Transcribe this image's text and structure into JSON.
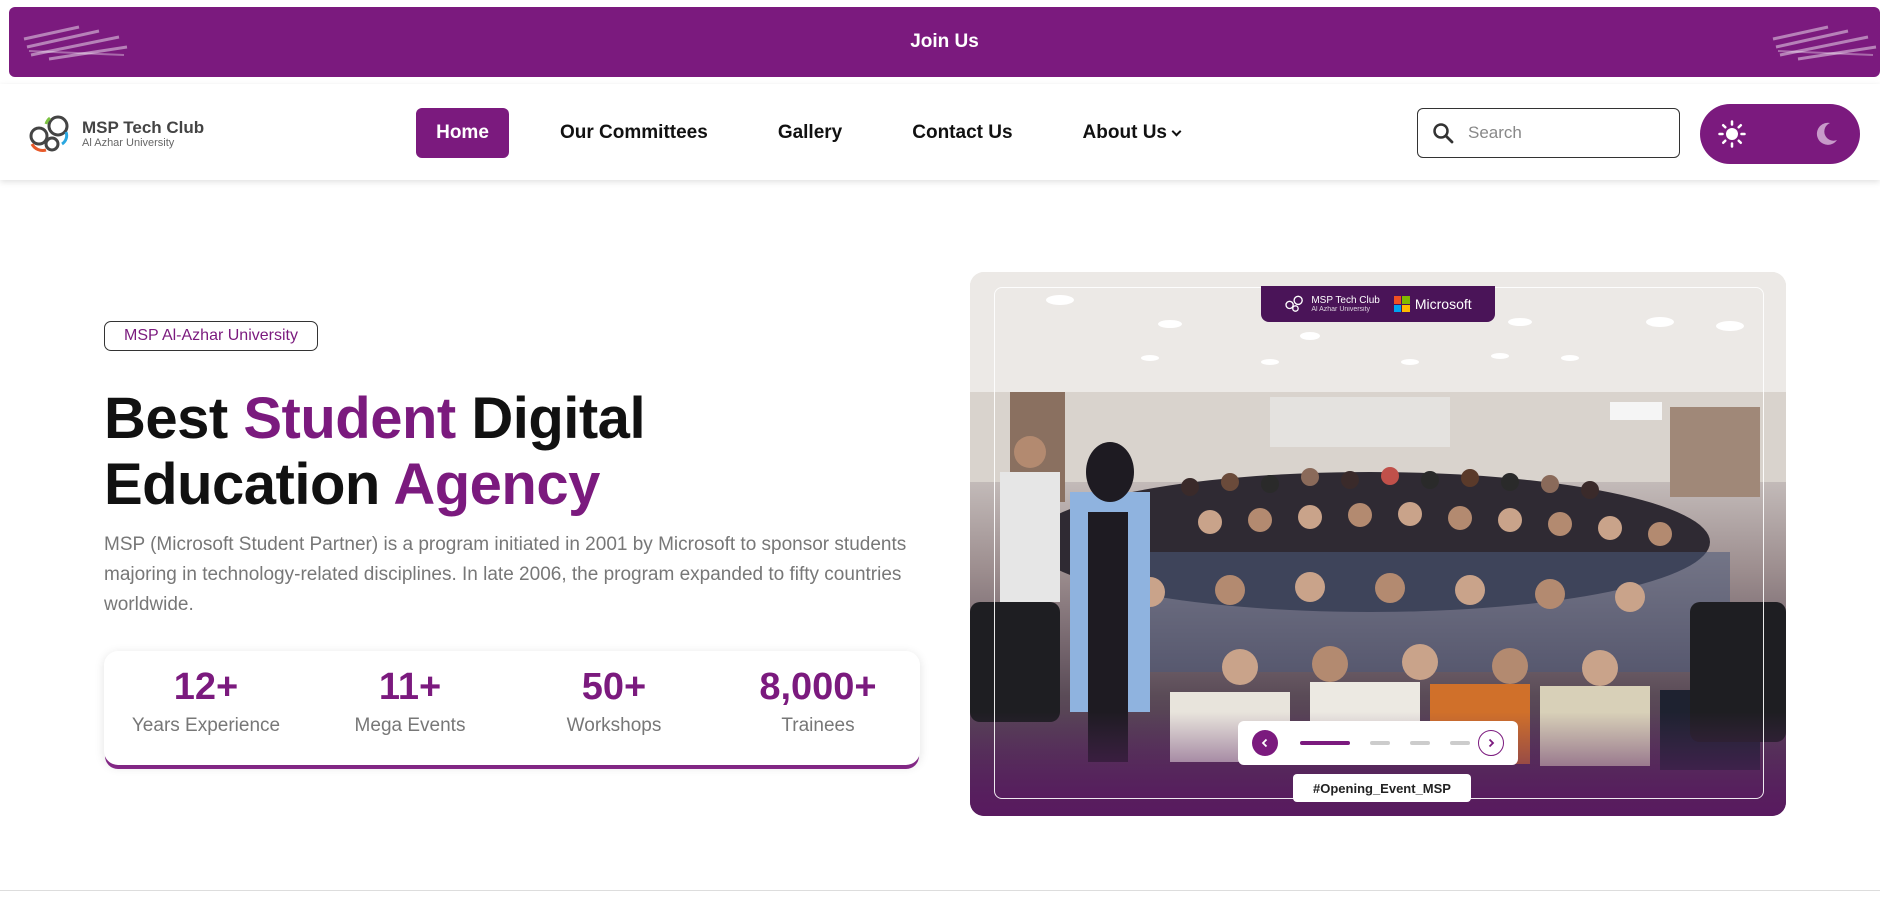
{
  "banner": {
    "label": "Join Us"
  },
  "logo": {
    "title": "MSP Tech Club",
    "subtitle": "Al Azhar University"
  },
  "nav": {
    "items": [
      {
        "label": "Home",
        "active": true
      },
      {
        "label": "Our Committees"
      },
      {
        "label": "Gallery"
      },
      {
        "label": "Contact Us"
      },
      {
        "label": "About Us",
        "has_dropdown": true
      }
    ]
  },
  "search": {
    "placeholder": "Search",
    "icon": "search-icon"
  },
  "theme_toggle": {
    "light_icon": "sun-icon",
    "dark_icon": "moon-icon"
  },
  "hero": {
    "tag": "MSP Al-Azhar University",
    "headline": {
      "word1": "Best",
      "word2": "Student",
      "word3": "Digital",
      "word4": "Education",
      "word5": "Agency"
    },
    "description": "MSP (Microsoft Student Partner) is a program initiated in 2001 by Microsoft to sponsor students majoring in technology-related disciplines. In late 2006, the program expanded to fifty countries worldwide.",
    "stats": [
      {
        "value": "12+",
        "label": "Years Experience"
      },
      {
        "value": "11+",
        "label": "Mega Events"
      },
      {
        "value": "50+",
        "label": "Workshops"
      },
      {
        "value": "8,000+",
        "label": "Trainees"
      }
    ]
  },
  "photo": {
    "brand_club": "MSP Tech Club",
    "brand_club_sub": "Al Azhar University",
    "brand_partner": "Microsoft",
    "caption": "#Opening_Event_MSP",
    "carousel_slides": 5,
    "carousel_active_index": 0
  },
  "colors": {
    "primary": "#7b1a7e",
    "text": "#111111",
    "muted": "#777777"
  }
}
